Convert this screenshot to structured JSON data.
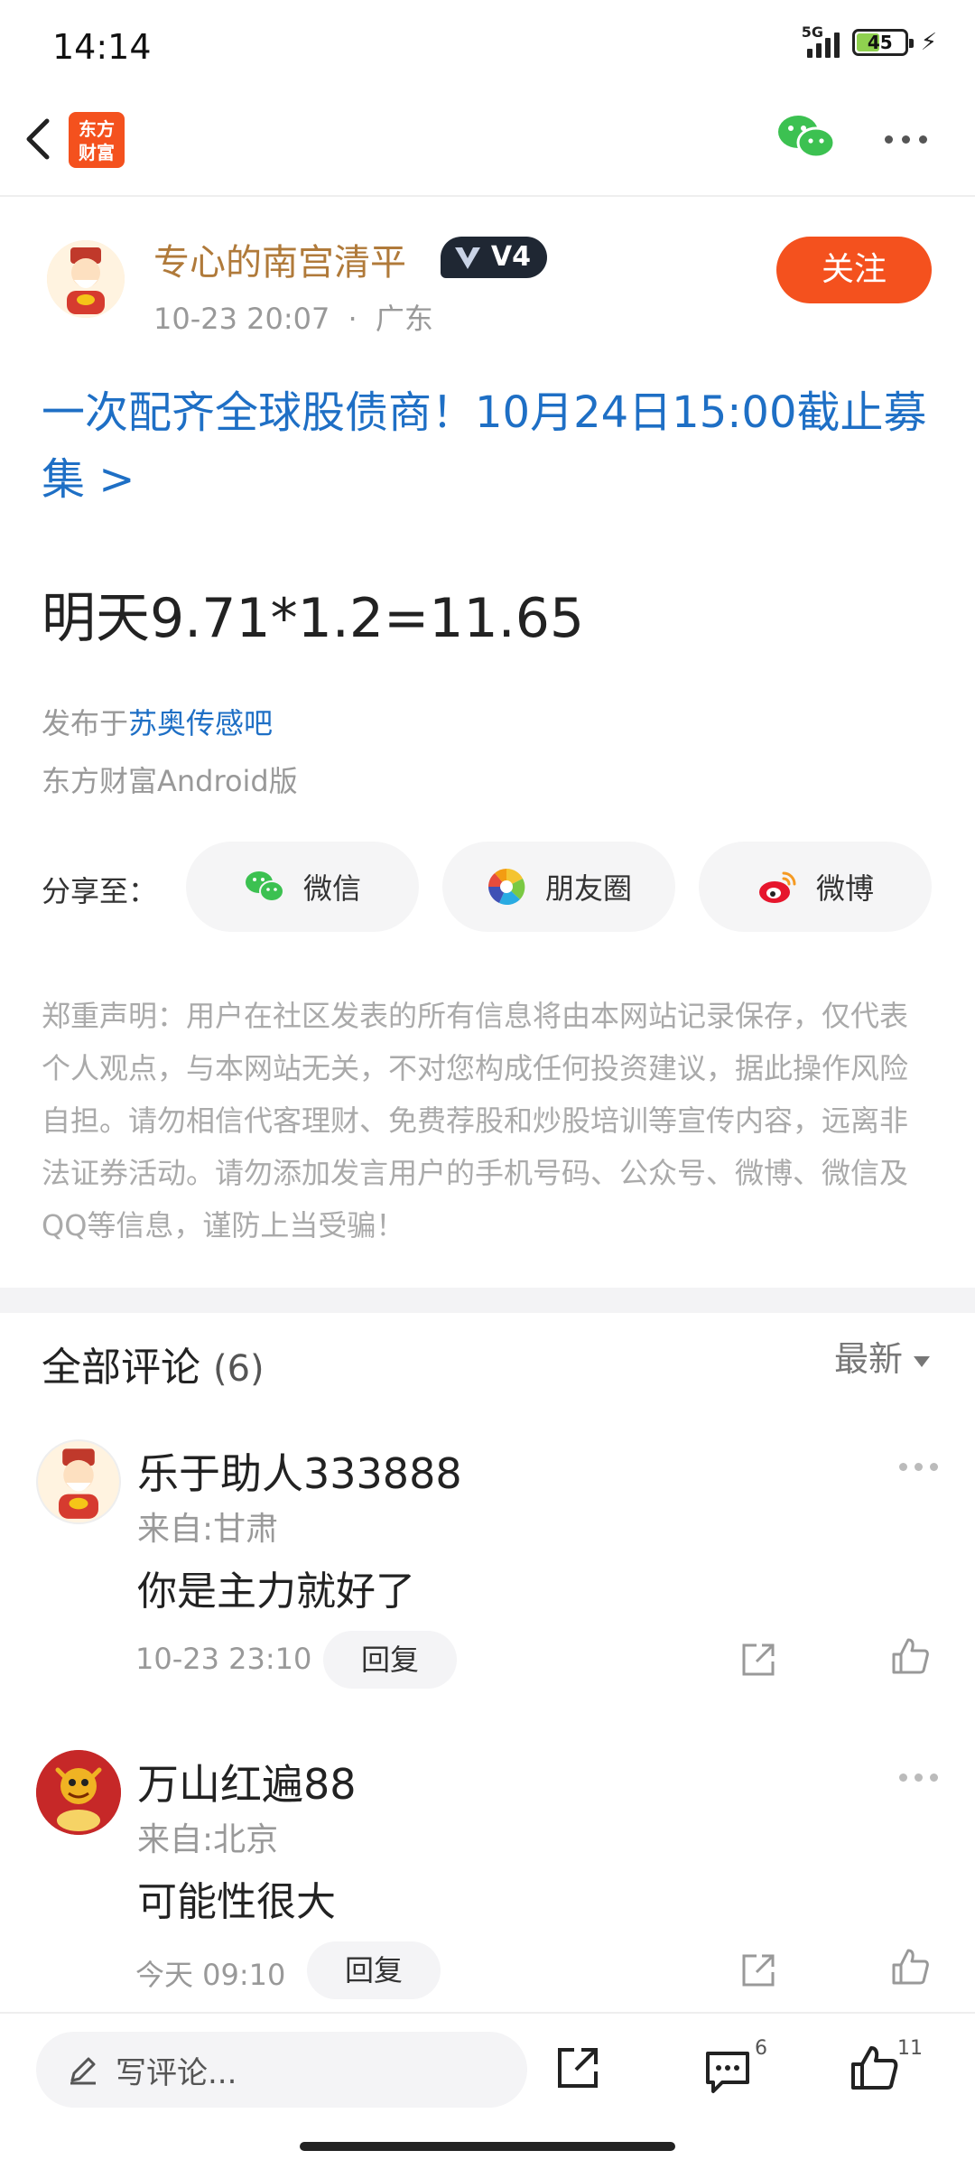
{
  "status_bar": {
    "time": "14:14",
    "network": "5G",
    "battery": "45"
  },
  "nav": {
    "brand_logo_text": "东方财富",
    "back_icon": "chevron-left-icon",
    "wechat_icon": "wechat-icon",
    "more_icon": "more-icon"
  },
  "author": {
    "name": "专心的南宫清平",
    "level_badge": "V4",
    "time": "10-23 20:07",
    "location": "广东",
    "follow_label": "关注"
  },
  "ad_link": "一次配齐全球股债商！10月24日15:00截止募集 >",
  "post": {
    "content": "明天9.71*1.2=11.65",
    "posted_in_prefix": "发布于",
    "board": "苏奥传感吧",
    "client": "东方财富Android版"
  },
  "share": {
    "label": "分享至：",
    "buttons": [
      {
        "label": "微信",
        "icon": "wechat-icon"
      },
      {
        "label": "朋友圈",
        "icon": "moments-icon"
      },
      {
        "label": "微博",
        "icon": "weibo-icon"
      }
    ]
  },
  "disclaimer": "郑重声明：用户在社区发表的所有信息将由本网站记录保存，仅代表个人观点，与本网站无关，不对您构成任何投资建议，据此操作风险自担。请勿相信代客理财、免费荐股和炒股培训等宣传内容，远离非法证券活动。请勿添加发言用户的手机号码、公众号、微博、微信及QQ等信息，谨防上当受骗！",
  "comments_section": {
    "title": "全部评论",
    "count": "(6)",
    "sort_label": "最新",
    "reply_label": "回复",
    "items": [
      {
        "user": "乐于助人333888",
        "location": "来自:甘肃",
        "text": "你是主力就好了",
        "time": "10-23 23:10"
      },
      {
        "user": "万山红遍88",
        "location": "来自:北京",
        "text": "可能性很大",
        "time": "今天 09:10"
      }
    ]
  },
  "bottom_bar": {
    "write_placeholder": "写评论...",
    "comment_count": "6",
    "like_count": "11"
  },
  "colors": {
    "accent": "#f4511e",
    "link": "#1e6fc5",
    "author_name": "#b07a3a"
  }
}
